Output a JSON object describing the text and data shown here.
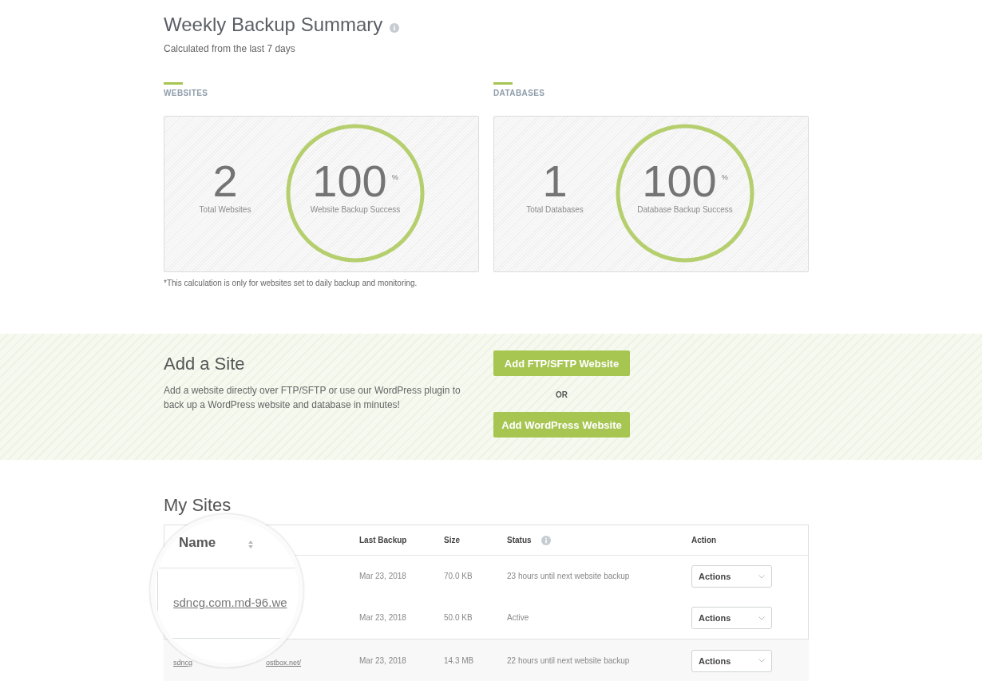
{
  "summary": {
    "title": "Weekly Backup Summary",
    "subtitle": "Calculated from the last 7 days",
    "groups": [
      {
        "label": "WEBSITES",
        "total": "2",
        "total_label": "Total Websites",
        "success": "100",
        "unit": "%",
        "success_label": "Website Backup Success",
        "level": 1
      },
      {
        "label": "DATABASES",
        "total": "1",
        "total_label": "Total Databases",
        "success": "100",
        "unit": "%",
        "success_label": "Database Backup Success",
        "level": 1
      }
    ],
    "footnote": "*This calculation is only for websites set to daily backup and monitoring."
  },
  "add_site": {
    "title": "Add a Site",
    "description": "Add a website directly over FTP/SFTP or use our WordPress plugin to back up a WordPress website and database in minutes!",
    "buttons": [
      "Add FTP/SFTP Website",
      "Add WordPress Website"
    ],
    "separator": "OR"
  },
  "my_sites": {
    "title": "My Sites",
    "columns": [
      "Last Backup",
      "Size",
      "Status",
      "Action"
    ],
    "rows": [
      {
        "last_backup": "Mar 23, 2018",
        "size": "70.0 KB",
        "status": "23 hours until next website backup",
        "action": "Actions"
      },
      {
        "last_backup": "Mar 23, 2018",
        "size": "50.0 KB",
        "status": "Active",
        "action": "Actions"
      },
      {
        "name_parts": [
          "sdncg",
          "ostbox.net/"
        ],
        "last_backup": "Mar 23, 2018",
        "size": "14.3 MB",
        "status": "22 hours until next website backup",
        "action": "Actions"
      }
    ],
    "magnifier": {
      "header": "Name",
      "link": "sdncg.com.md-96.we"
    }
  }
}
